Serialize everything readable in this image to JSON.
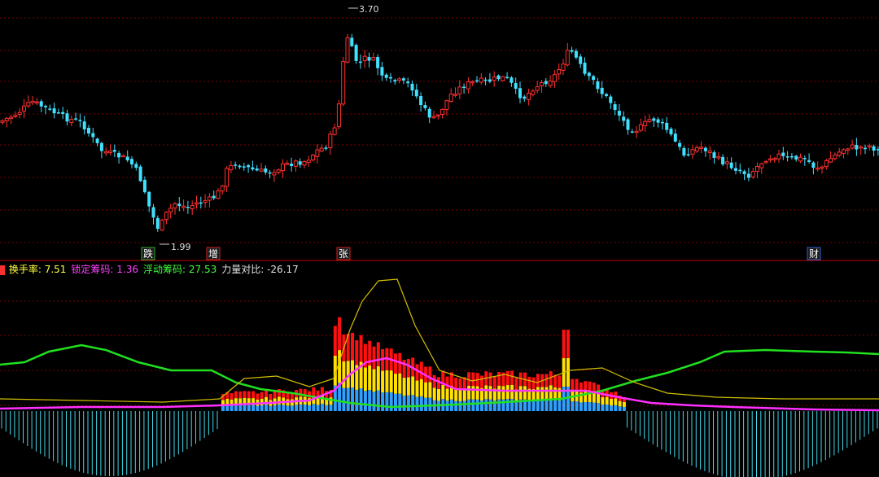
{
  "upper": {
    "high_label": "3.70",
    "low_label": "1.99",
    "markers": [
      {
        "text": "跌",
        "color": "#2fa62f",
        "index": 1
      },
      {
        "text": "增",
        "color": "#d02020",
        "index": 2
      },
      {
        "text": "张",
        "color": "#d02020",
        "index": 3
      },
      {
        "text": "财",
        "color": "#3060d0",
        "index": 4
      }
    ]
  },
  "indicator": {
    "fields": [
      {
        "label": "换手率:",
        "value": "7.51",
        "color": "#ffff40"
      },
      {
        "label": "锁定筹码:",
        "value": "1.36",
        "color": "#ff40ff"
      },
      {
        "label": "浮动筹码:",
        "value": "27.53",
        "color": "#40ff40"
      },
      {
        "label": "力量对比:",
        "value": "-26.17",
        "color": "#e0e0e0"
      }
    ]
  },
  "colors": {
    "up": "#ff3030",
    "down": "#40e0ff",
    "grid": "#7a0000",
    "green_line": "#20e020",
    "yellow_line": "#d0c000",
    "magenta_line": "#ff30ff",
    "bar_red": "#ff1010",
    "bar_yellow": "#ffe000",
    "bar_blue": "#30a0ff",
    "cyan_histo": "#40d8e8"
  }
}
